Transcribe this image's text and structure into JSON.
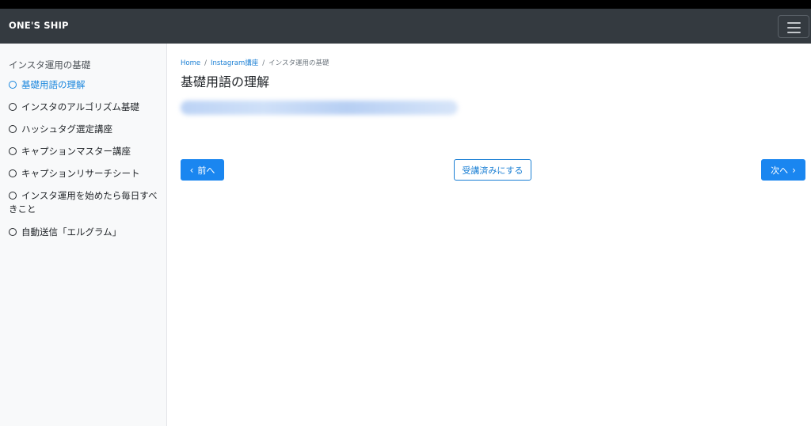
{
  "brand": "ONE'S SHIP",
  "sidebar": {
    "title": "インスタ運用の基礎",
    "items": [
      {
        "label": "基礎用語の理解",
        "active": true
      },
      {
        "label": "インスタのアルゴリズム基礎",
        "active": false
      },
      {
        "label": "ハッシュタグ選定講座",
        "active": false
      },
      {
        "label": "キャプションマスター講座",
        "active": false
      },
      {
        "label": "キャプションリサーチシート",
        "active": false
      },
      {
        "label": "インスタ運用を始めたら毎日すべきこと",
        "active": false
      },
      {
        "label": "自動送信「エルグラム」",
        "active": false
      }
    ]
  },
  "breadcrumb": {
    "home": "Home",
    "sep": "/",
    "course": "Instagram講座",
    "current": "インスタ運用の基礎"
  },
  "main": {
    "title": "基礎用語の理解"
  },
  "buttons": {
    "prev": "前へ",
    "complete": "受講済みにする",
    "next": "次へ",
    "prev_icon": "chevron-left-icon",
    "next_icon": "chevron-right-icon"
  },
  "colors": {
    "navbar": "#343a40",
    "accent": "#1a86f0",
    "sidebar_bg": "#f8f9fa"
  }
}
